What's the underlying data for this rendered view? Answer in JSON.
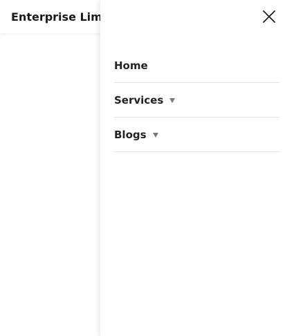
{
  "header": {
    "brand": "Enterprise Limite"
  },
  "drawer": {
    "close_icon": "close-icon",
    "items": [
      {
        "label": "Home",
        "has_caret": false
      },
      {
        "label": "Services",
        "has_caret": true,
        "caret_icon": "caret-down-icon"
      },
      {
        "label": "Blogs",
        "has_caret": true,
        "caret_icon": "caret-down-icon"
      }
    ]
  },
  "colors": {
    "text": "#222222",
    "divider": "#e2e2e2",
    "caret": "#7a7a7a",
    "background": "#ffffff"
  }
}
